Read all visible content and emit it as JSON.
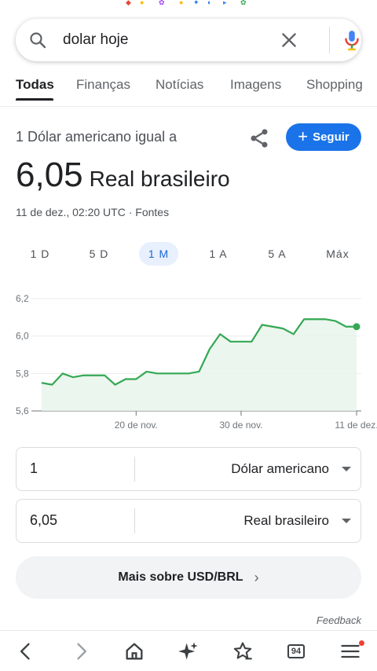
{
  "search": {
    "query": "dolar hoje"
  },
  "tabs": [
    {
      "label": "Todas",
      "active": true
    },
    {
      "label": "Finanças",
      "active": false
    },
    {
      "label": "Notícias",
      "active": false
    },
    {
      "label": "Imagens",
      "active": false
    },
    {
      "label": "Shopping",
      "active": false
    }
  ],
  "converter": {
    "header": "1 Dólar americano igual a",
    "follow_label": "Seguir",
    "rate_value": "6,05",
    "rate_currency": "Real brasileiro",
    "meta": "11 de dez., 02:20 UTC · Fontes",
    "ranges": [
      {
        "label": "1 D",
        "active": false
      },
      {
        "label": "5 D",
        "active": false
      },
      {
        "label": "1 M",
        "active": true
      },
      {
        "label": "1 A",
        "active": false
      },
      {
        "label": "5 A",
        "active": false
      },
      {
        "label": "Máx",
        "active": false
      }
    ],
    "from": {
      "amount": "1",
      "currency": "Dólar americano"
    },
    "to": {
      "amount": "6,05",
      "currency": "Real brasileiro"
    },
    "more_label": "Mais sobre USD/BRL"
  },
  "feedback_label": "Feedback",
  "bottom_nav": {
    "tab_count": "94"
  },
  "colors": {
    "accent": "#1a73e8",
    "line": "#34a853",
    "area": "#e6f4ea"
  },
  "chart_data": {
    "type": "area",
    "x": [
      "11/11",
      "12/11",
      "13/11",
      "14/11",
      "15/11",
      "16/11",
      "17/11",
      "18/11",
      "19/11",
      "20/11",
      "21/11",
      "22/11",
      "23/11",
      "24/11",
      "25/11",
      "26/11",
      "27/11",
      "28/11",
      "29/11",
      "30/11",
      "01/12",
      "02/12",
      "03/12",
      "04/12",
      "05/12",
      "06/12",
      "07/12",
      "08/12",
      "09/12",
      "10/12",
      "11/12"
    ],
    "values": [
      5.75,
      5.74,
      5.8,
      5.78,
      5.79,
      5.79,
      5.79,
      5.74,
      5.77,
      5.77,
      5.81,
      5.8,
      5.8,
      5.8,
      5.8,
      5.81,
      5.93,
      6.01,
      5.97,
      5.97,
      5.97,
      6.06,
      6.05,
      6.04,
      6.01,
      6.09,
      6.09,
      6.09,
      6.08,
      6.05,
      6.05
    ],
    "y_ticks": [
      "5,6",
      "5,8",
      "6,0",
      "6,2"
    ],
    "ylim": [
      5.6,
      6.2
    ],
    "x_ticks": [
      {
        "label": "20 de nov.",
        "index": 9
      },
      {
        "label": "30 de nov.",
        "index": 19
      },
      {
        "label": "11 de dez.",
        "index": 30
      }
    ],
    "grid": true
  }
}
